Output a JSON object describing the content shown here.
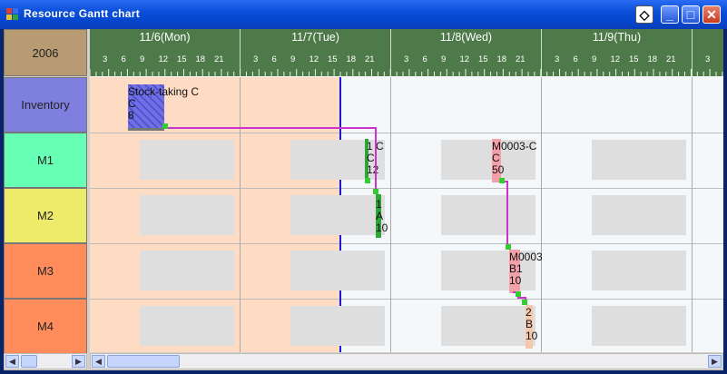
{
  "window": {
    "title": "Resource Gantt chart"
  },
  "rows": {
    "year": "2006",
    "items": [
      {
        "label": "Inventory",
        "color": "#7f7fdf"
      },
      {
        "label": "M1",
        "color": "#66ffb3"
      },
      {
        "label": "M2",
        "color": "#eeea6a"
      },
      {
        "label": "M3",
        "color": "#ff8c5a"
      },
      {
        "label": "M4",
        "color": "#ff8c5a"
      }
    ]
  },
  "days": [
    {
      "label": "11/6(Mon)"
    },
    {
      "label": "11/7(Tue)"
    },
    {
      "label": "11/8(Wed)"
    },
    {
      "label": "11/9(Thu)"
    }
  ],
  "hours": [
    "3",
    "6",
    "9",
    "12",
    "15",
    "18",
    "21"
  ],
  "last_hour": "3",
  "tasks": {
    "inventory": {
      "lines": [
        "Stock-taking C",
        "C",
        "8"
      ]
    },
    "m1_a": {
      "lines": [
        "1 C",
        "C",
        "12"
      ]
    },
    "m1_b": {
      "lines": [
        "M0003-C",
        "C",
        "50"
      ]
    },
    "m2_a": {
      "lines": [
        "1",
        "A",
        "10"
      ]
    },
    "m3_a": {
      "lines": [
        "M0003",
        "B1",
        "10"
      ]
    },
    "m4_a": {
      "lines": [
        "2",
        "B",
        "10"
      ]
    }
  },
  "colors": {
    "header_green": "#4e7a4a",
    "past_bg": "#fedcc4",
    "now_line": "#1a1ad0",
    "link": "#cc33cc",
    "task_pink": "#f4a0a8",
    "task_green": "#2fa43a",
    "task_blue": "#6f6fe8"
  }
}
